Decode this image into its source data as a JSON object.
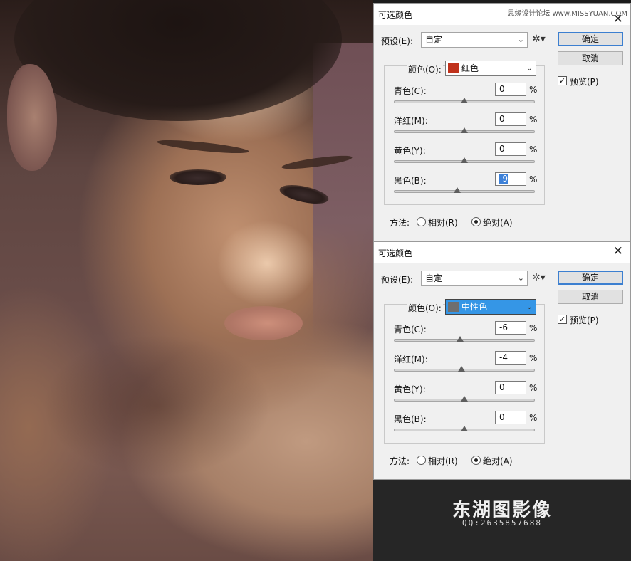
{
  "dialogs": [
    {
      "title": "可选颜色",
      "watermark": "思缘设计论坛 www.MISSYUAN.COM",
      "preset_label": "预设(E):",
      "preset_value": "自定",
      "ok_label": "确定",
      "cancel_label": "取消",
      "preview_label": "预览(P)",
      "preview_checked": true,
      "color_label": "颜色(O):",
      "color_value": "红色",
      "color_swatch": "#c0321c",
      "sliders": [
        {
          "label": "青色(C):",
          "value": "0",
          "fraction": 0.5
        },
        {
          "label": "洋红(M):",
          "value": "0",
          "fraction": 0.5
        },
        {
          "label": "黄色(Y):",
          "value": "0",
          "fraction": 0.5
        },
        {
          "label": "黑色(B):",
          "value": "-9",
          "fraction": 0.45,
          "highlighted": true
        }
      ],
      "percent": "%",
      "method_label": "方法:",
      "relative_label": "相对(R)",
      "absolute_label": "绝对(A)",
      "method_selected": "absolute"
    },
    {
      "title": "可选颜色",
      "preset_label": "预设(E):",
      "preset_value": "自定",
      "ok_label": "确定",
      "cancel_label": "取消",
      "preview_label": "预览(P)",
      "preview_checked": true,
      "color_label": "颜色(O):",
      "color_value": "中性色",
      "color_swatch": "#6e6e6e",
      "sliders": [
        {
          "label": "青色(C):",
          "value": "-6",
          "fraction": 0.47
        },
        {
          "label": "洋红(M):",
          "value": "-4",
          "fraction": 0.48
        },
        {
          "label": "黄色(Y):",
          "value": "0",
          "fraction": 0.5
        },
        {
          "label": "黑色(B):",
          "value": "0",
          "fraction": 0.5
        }
      ],
      "percent": "%",
      "method_label": "方法:",
      "relative_label": "相对(R)",
      "absolute_label": "绝对(A)",
      "method_selected": "absolute"
    }
  ],
  "logo": {
    "name": "东湖图影像",
    "qq": "QQ:2635857688"
  },
  "colors": {
    "accent_selection": "#3596e6",
    "primary_button_border": "#3c7fd0"
  },
  "icons": {
    "gear": "gear-icon",
    "close": "close-icon",
    "dropdown": "chevron-down-icon"
  }
}
